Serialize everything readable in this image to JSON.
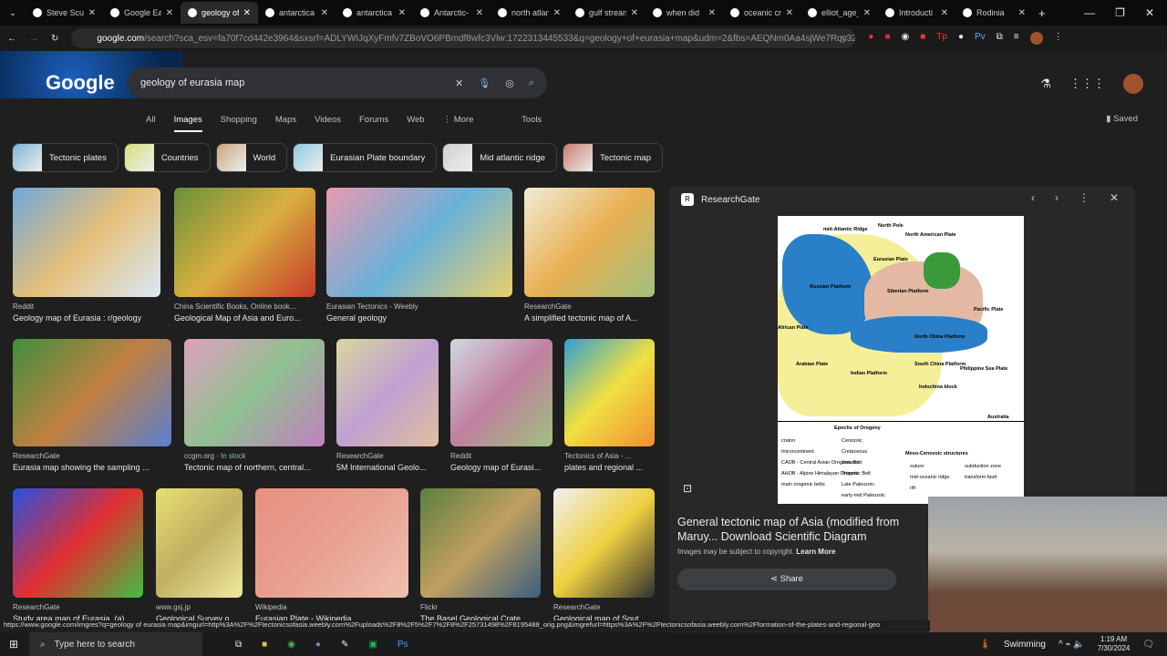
{
  "browser": {
    "tabs": [
      {
        "title": "Steve Scull",
        "icon": "x-icon"
      },
      {
        "title": "Google Earth",
        "icon": "earth-icon"
      },
      {
        "title": "geology of",
        "icon": "google-icon",
        "active": true
      },
      {
        "title": "antarctica",
        "icon": "google-icon"
      },
      {
        "title": "antarctica",
        "icon": "google-icon"
      },
      {
        "title": "Antarctic-",
        "icon": "wikipedia-icon"
      },
      {
        "title": "north atlan",
        "icon": "google-icon"
      },
      {
        "title": "gulf strean",
        "icon": "google-icon"
      },
      {
        "title": "when did",
        "icon": "google-icon"
      },
      {
        "title": "oceanic cr",
        "icon": "google-icon"
      },
      {
        "title": "elliot_age_",
        "icon": "check-icon"
      },
      {
        "title": "Introducti",
        "icon": "sn-icon"
      },
      {
        "title": "Rodinia",
        "icon": "google-icon"
      }
    ],
    "url_domain": "google.com",
    "url_rest": "/search?sca_esv=fa70f7cd442e3964&sxsrf=ADLYWIJqXyFmfv7ZBoVO6PBmdf8wfc3Vlw:1722313445533&q=geology+of+eurasia+map&udm=2&fbs=AEQNm0Aa4sjWe7Rqy32pFwRj0UkWd8..."
  },
  "google": {
    "logo": "Google",
    "query": "geology of eurasia map",
    "nav": [
      "All",
      "Images",
      "Shopping",
      "Maps",
      "Videos",
      "Forums",
      "Web",
      "⋮ More"
    ],
    "active_nav": "Images",
    "tools": "Tools",
    "saved": "Saved",
    "chips": [
      "Tectonic plates",
      "Countries",
      "World",
      "Eurasian Plate boundary",
      "Mid atlantic ridge",
      "Tectonic map"
    ]
  },
  "results": [
    {
      "source": "Reddit",
      "title": "Geology map of Eurasia : r/geology"
    },
    {
      "source": "China Scientific Books, Online book...",
      "title": "Geological Map of Asia and Euro..."
    },
    {
      "source": "Eurasian Tectonics - Weebly",
      "title": "General geology"
    },
    {
      "source": "ResearchGate",
      "title": "A simplified tectonic map of A..."
    },
    {
      "source": "ResearchGate",
      "title": "Eurasia map showing the sampling ..."
    },
    {
      "source": "ccgm.org",
      "badge": "In stock",
      "title": "Tectonic map of northern, central..."
    },
    {
      "source": "ResearchGate",
      "title": "5M International Geolo..."
    },
    {
      "source": "Reddit",
      "title": "Geology map of Eurasi..."
    },
    {
      "source": "Tectonics of Asia - ...",
      "title": "plates and regional ..."
    },
    {
      "source": "ResearchGate",
      "title": "Study area map of Eurasia. (a)..."
    },
    {
      "source": "www.gsj.jp",
      "title": "Geological Survey o..."
    },
    {
      "source": "Wikipedia",
      "title": "Eurasian Plate - Wikipedia"
    },
    {
      "source": "Flickr",
      "title": "The Basel Geological Crate..."
    },
    {
      "source": "ResearchGate",
      "title": "Geological map of Sout..."
    }
  ],
  "preview": {
    "source": "ResearchGate",
    "title": "General tectonic map of Asia (modified from Maruy... Download Scientific Diagram",
    "copyright": "Images may be subject to copyright.",
    "learn_more": "Learn More",
    "share": "Share",
    "map_labels": [
      "mid-Atlantic Ridge",
      "North Pole",
      "North American Plate",
      "Eurasian Plate",
      "Russian Platform",
      "Siberian Platform",
      "Pacific Plate",
      "African Plate",
      "Arabian Plate",
      "Indian Platform",
      "North China Platform",
      "South China Platform",
      "Philippine Sea Plate",
      "Indochina block",
      "Australia"
    ],
    "legend_title": "Epochs of Orogeny",
    "legend": [
      "craton",
      "microcontinent",
      "CAOB - Central Asian Orogenic Belt",
      "AHOB - Alpine Himalayan Orogenic Belt",
      "main orogenic belts",
      "Cenozoic",
      "Cretaceous",
      "Jurassic",
      "Triassic",
      "Late Paleozoic",
      "early-mid Paleozoic"
    ],
    "structures_title": "Meso-Cenozoic structures",
    "structures": [
      "suture",
      "subduction zone",
      "mid-oceanic ridge",
      "transform fault",
      "rift"
    ]
  },
  "status_url": "https://www.google.com/imgres?q=geology of eurasia map&imgurl=http%3A%2F%2Ftectonicsofasia.weebly.com%2Fuploads%2F8%2F5%2F7%2F8%2F25731498%2F8195488_orig.png&imgrefurl=https%3A%2F%2Ftectonicsofasia.weebly.com%2Fformation-of-the-plates-and-regional-geo",
  "taskbar": {
    "search_placeholder": "Type here to search",
    "weather": "Swimming",
    "time": "1:19 AM",
    "date": "7/30/2024"
  }
}
